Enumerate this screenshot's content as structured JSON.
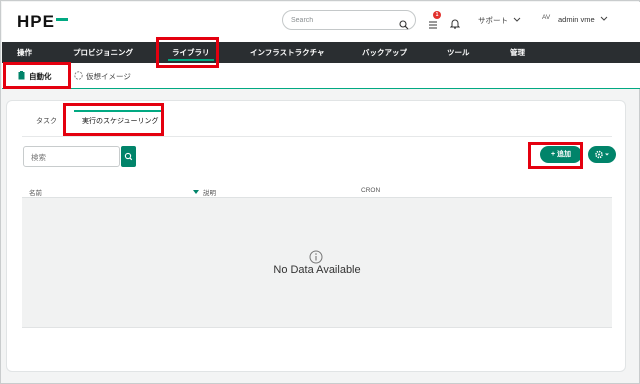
{
  "header": {
    "logo_text": "HPE",
    "search_placeholder": "Search",
    "notification_count": "1",
    "support_label": "サポート",
    "avatar_initials": "AV",
    "username": "admin vme"
  },
  "nav": {
    "items": [
      {
        "label": "操作"
      },
      {
        "label": "プロビジョニング"
      },
      {
        "label": "ライブラリ"
      },
      {
        "label": "インフラストラクチャ"
      },
      {
        "label": "バックアップ"
      },
      {
        "label": "ツール"
      },
      {
        "label": "管理"
      }
    ],
    "active": "ライブラリ"
  },
  "subnav": {
    "items": [
      {
        "label": "自動化"
      },
      {
        "label": "仮想イメージ"
      }
    ],
    "active": "自動化"
  },
  "tabs": {
    "items": [
      {
        "label": "タスク"
      },
      {
        "label": "実行のスケジューリング"
      }
    ],
    "active": "実行のスケジューリング"
  },
  "toolbar": {
    "filter_placeholder": "検索",
    "add_label": "+ 追加"
  },
  "table": {
    "columns": [
      "名前",
      "説明",
      "CRON"
    ],
    "sorted_column": "説明",
    "empty_message": "No Data Available"
  },
  "colors": {
    "accent": "#01a982",
    "button": "#01846a",
    "nav_bg": "#2a2e31",
    "highlight": "#e4000f",
    "badge": "#e2312d"
  }
}
